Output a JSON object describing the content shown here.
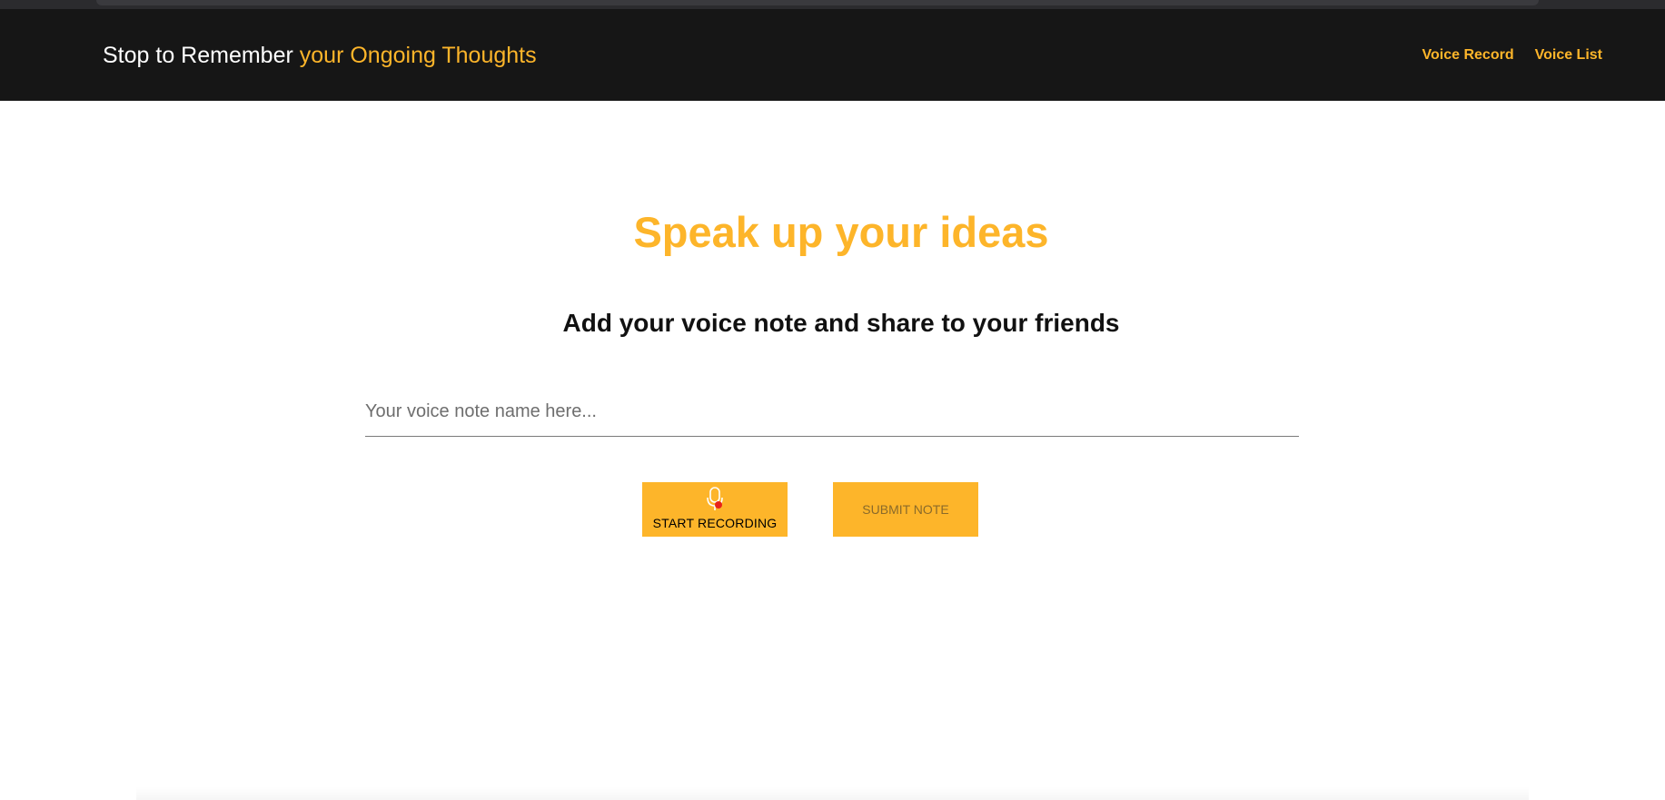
{
  "header": {
    "brand_prefix": "Stop to Remember",
    "brand_accent": "your Ongoing Thoughts",
    "nav": [
      {
        "label": "Voice Record"
      },
      {
        "label": "Voice List"
      }
    ]
  },
  "main": {
    "title": "Speak up your ideas",
    "subtitle": "Add your voice note and share to your friends",
    "note_name_input": {
      "value": "",
      "placeholder": "Your voice note name here..."
    },
    "record_button": {
      "label": "START RECORDING",
      "icon": "microphone-icon",
      "indicator": "recording-dot"
    },
    "submit_button": {
      "label": "SUBMIT NOTE"
    }
  },
  "colors": {
    "accent": "#fdb52a",
    "navbar_bg": "#161616",
    "record_dot": "#e8231a"
  }
}
